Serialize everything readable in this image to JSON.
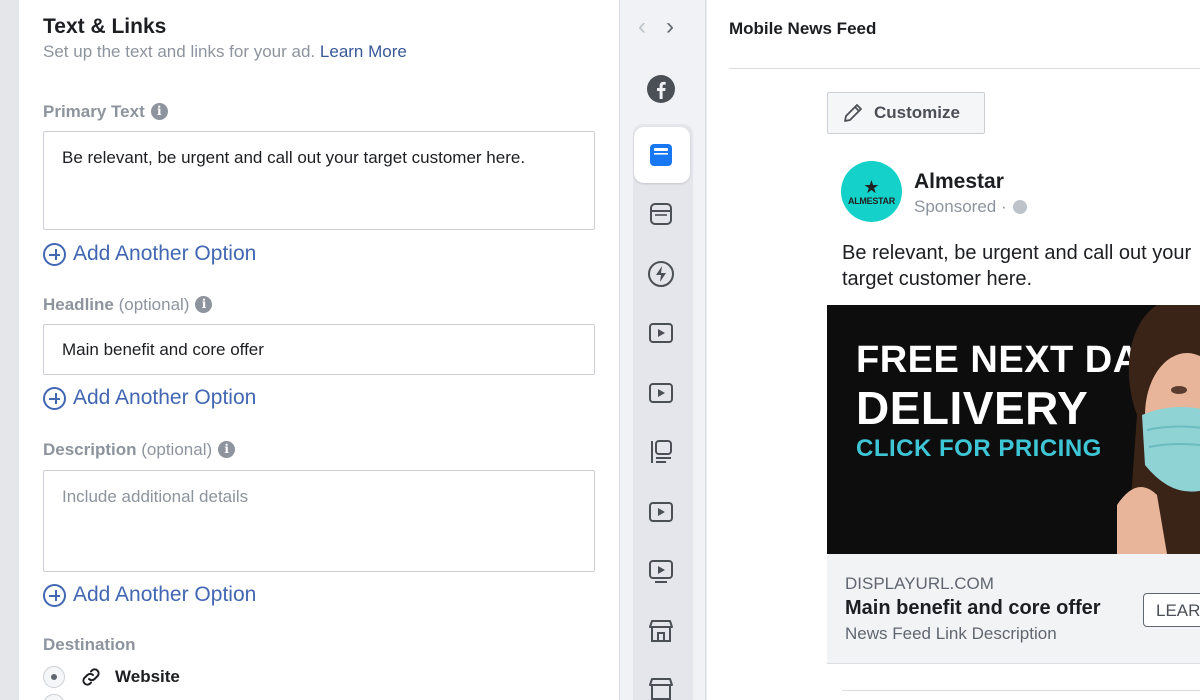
{
  "form": {
    "title": "Text & Links",
    "subtitle": "Set up the text and links for your ad.",
    "learn_more": "Learn More",
    "primary_text": {
      "label": "Primary Text",
      "value": "Be relevant, be urgent and call out your target customer here."
    },
    "headline": {
      "label": "Headline",
      "optional": "(optional)",
      "value": "Main benefit and core offer"
    },
    "description": {
      "label": "Description",
      "optional": "(optional)",
      "placeholder": "Include additional details"
    },
    "add_option": "Add Another Option",
    "destination": {
      "label": "Destination",
      "options": [
        {
          "label": "Website",
          "selected": true
        }
      ]
    }
  },
  "placements": {
    "icons": [
      "facebook-icon",
      "feed-icon",
      "feed-alt-icon",
      "instant-articles-icon",
      "video-feed-icon",
      "video-icon",
      "stories-icon",
      "in-stream-video-icon",
      "video-search-icon",
      "marketplace-icon",
      "marketplace-alt-icon"
    ],
    "active_index": 1
  },
  "preview": {
    "title": "Mobile News Feed",
    "customize": "Customize",
    "page_name": "Almestar",
    "avatar_text": "ALMESTAR",
    "sponsored": "Sponsored ·",
    "post_text": "Be relevant, be urgent and call out your target customer here.",
    "ad_image": {
      "line1": "FREE NEXT DAY",
      "line2": "DELIVERY",
      "line3": "CLICK FOR PRICING"
    },
    "display_url": "DISPLAYURL.COM",
    "link_headline": "Main benefit and core offer",
    "link_description": "News Feed Link Description",
    "cta": "LEARN MORE"
  },
  "colors": {
    "link_blue": "#4267b2",
    "avatar_teal": "#14d1c9",
    "ad_cyan": "#3ec6d6"
  }
}
